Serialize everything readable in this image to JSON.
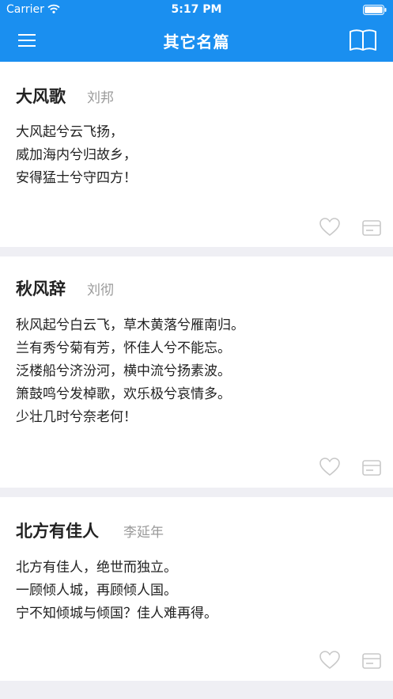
{
  "status_bar": {
    "carrier": "Carrier",
    "time": "5:17 PM"
  },
  "nav": {
    "title": "其它名篇"
  },
  "poems": [
    {
      "title": "大风歌",
      "author": "刘邦",
      "lines": [
        "大风起兮云飞扬，",
        "威加海内兮归故乡，",
        "安得猛士兮守四方！"
      ]
    },
    {
      "title": "秋风辞",
      "author": "刘彻",
      "lines": [
        "秋风起兮白云飞，草木黄落兮雁南归。",
        "兰有秀兮菊有芳，怀佳人兮不能忘。",
        "泛楼船兮济汾河，横中流兮扬素波。",
        "箫鼓鸣兮发棹歌，欢乐极兮哀情多。",
        "少壮几时兮奈老何！"
      ]
    },
    {
      "title": "北方有佳人",
      "author": "李延年",
      "lines": [
        "北方有佳人，绝世而独立。",
        "一顾倾人城，再顾倾人国。",
        "宁不知倾城与倾国？佳人难再得。"
      ]
    }
  ],
  "icons": {
    "menu": "menu-icon",
    "book": "book-icon",
    "heart": "heart-icon",
    "card": "card-icon"
  },
  "colors": {
    "accent": "#1a8ff0",
    "background": "#efeff4",
    "card": "#ffffff",
    "text": "#222222",
    "muted": "#9a9a9a",
    "icon_muted": "#c8c8c8"
  }
}
